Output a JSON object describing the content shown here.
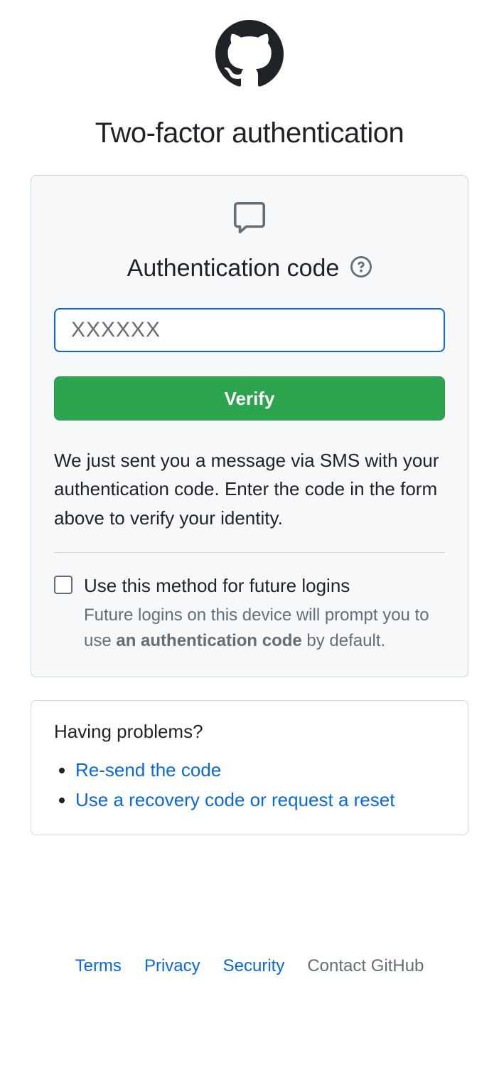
{
  "page_title": "Two-factor authentication",
  "auth": {
    "section_title": "Authentication code",
    "input_placeholder": "XXXXXX",
    "verify_label": "Verify",
    "info_text": "We just sent you a message via SMS with your authentication code. Enter the code in the form above to verify your identity.",
    "checkbox_label": "Use this method for future logins",
    "checkbox_hint_pre": "Future logins on this device will prompt you to use ",
    "checkbox_hint_bold": "an authentication code",
    "checkbox_hint_post": " by default."
  },
  "problems": {
    "title": "Having problems?",
    "items": [
      "Re-send the code",
      "Use a recovery code or request a reset"
    ]
  },
  "footer": {
    "terms": "Terms",
    "privacy": "Privacy",
    "security": "Security",
    "contact": "Contact GitHub"
  }
}
